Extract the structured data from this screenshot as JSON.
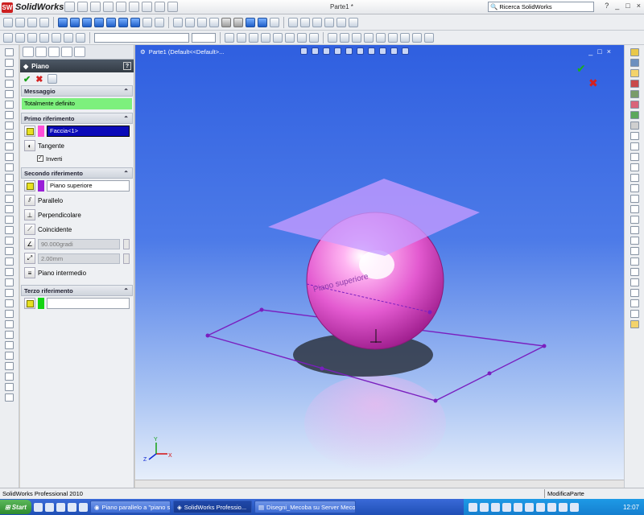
{
  "app": {
    "logo_text": "SolidWorks",
    "logo_mark": "SW",
    "document_title": "Parte1 *"
  },
  "search": {
    "value": "Ricerca SolidWorks"
  },
  "window_controls": {
    "minimize": "_",
    "restore": "□",
    "close": "×",
    "help": "?"
  },
  "property_manager": {
    "title": "Piano",
    "help": "?",
    "ok_icon": "✔",
    "cancel_icon": "✖",
    "messaggio": {
      "title": "Messaggio",
      "text": "Totalmente definito"
    },
    "primo": {
      "title": "Primo riferimento",
      "selection": "Faccia<1>",
      "option": "Tangente",
      "checkbox": "Inverti"
    },
    "secondo": {
      "title": "Secondo riferimento",
      "selection": "Piano superiore",
      "options": [
        "Parallelo",
        "Perpendicolare",
        "Coincidente"
      ],
      "angle": "90.000gradi",
      "distance": "2.00mm",
      "intermediate": "Piano intermedio"
    },
    "terzo": {
      "title": "Terzo riferimento",
      "selection": ""
    }
  },
  "viewport": {
    "tree_label": "Parte1  (Default<<Default>...",
    "plane_label": "Piano superiore",
    "triad": {
      "x": "X",
      "y": "Y",
      "z": "Z"
    }
  },
  "statusbar": {
    "left": "SolidWorks Professional 2010",
    "right": "ModificaParte"
  },
  "taskbar": {
    "start": "Start",
    "tasks": [
      "Piano parallelo a \"piano s...",
      "SolidWorks Professio...",
      "Disegni_Mecoba su Server Mecoba (Server"
    ],
    "clock": "12:07"
  },
  "colors": {
    "accent": "#2f5fe0",
    "pink": "#d946c4",
    "plane": "#b48cff",
    "msg_green": "#7df07d",
    "selection_blue": "#0a0ab8",
    "sketch_purple": "#7a1fbf"
  }
}
